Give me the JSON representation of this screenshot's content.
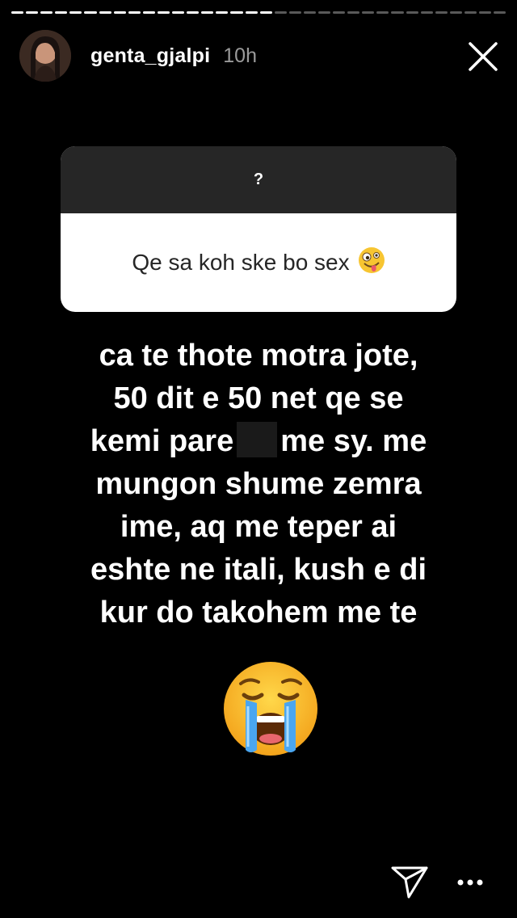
{
  "story": {
    "progress": {
      "segments": [
        1,
        1,
        1,
        1,
        1,
        1,
        1,
        1,
        1,
        1,
        1,
        1,
        1,
        1,
        1,
        1,
        1,
        1,
        0,
        0,
        0,
        0,
        0,
        0,
        0,
        0,
        0,
        0,
        0,
        0,
        0,
        0,
        0,
        0
      ]
    },
    "header": {
      "username": "genta_gjalpi",
      "time_ago": "10h",
      "avatar_icon": "profile-photo",
      "close_icon": "close-icon"
    },
    "question_sticker": {
      "prompt": "?",
      "question": "Qe sa koh ske bo sex",
      "question_emoji": "🤪"
    },
    "answer": {
      "line1": "ca te thote motra jote,",
      "line2": "50 dit e 50 net qe se",
      "line3_before": "kemi pare",
      "line3_after": "me sy. me",
      "line4": "mungon shume zemra",
      "line5": "ime, aq me teper ai",
      "line6": "eshte ne itali, kush e di",
      "line7": "kur do takohem me te"
    },
    "reaction_emoji": "loudly-crying-face",
    "footer": {
      "send_icon": "direct-send-icon",
      "more_icon": "more-options-icon"
    }
  },
  "colors": {
    "background": "#000000",
    "sticker_header": "#262626",
    "sticker_body": "#ffffff",
    "text_primary": "#ffffff",
    "text_secondary": "#999999"
  }
}
